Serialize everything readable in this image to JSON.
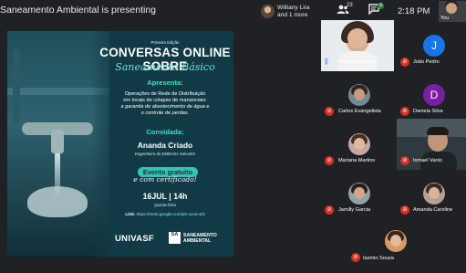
{
  "header": {
    "presenting_text": "Saneamento Ambiental is presenting",
    "pinned_names": [
      "Williany Lira",
      "and 1 more"
    ],
    "participants_count": "23",
    "chat_badge": "9",
    "time": "2:18 PM",
    "self_label": "You"
  },
  "slide": {
    "edition": "Primeira Edição",
    "title": "CONVERSAS ONLINE SOBRE",
    "subtitle": "Saneamento Básico",
    "presents_heading": "Apresenta:",
    "talk_line1": "Operações de Rede de Distribuição",
    "talk_line2": "em locais de colapso de mananciais:",
    "talk_line3": "a garantia do abastecimento de água e",
    "talk_line4": "o controle de perdas.",
    "guest_heading": "Convidada:",
    "guest_name": "Ananda Criado",
    "guest_role": "Engenheira da EMBASA Salvador",
    "free_event": "Evento gratuito",
    "certificate": "e com certificado!",
    "date": "16JUL | 14h",
    "weekday": "Quinta-feira",
    "link_label": "Link:",
    "link_url": "https://meet.google.com/pir-ucvw-phi",
    "logo_univasf": "UNIVASF",
    "logo_sa_mark": "SA",
    "logo_sa_line1": "SANEAMENTO",
    "logo_sa_line2": "AMBIENTAL"
  },
  "participants": [
    {
      "name": "Ananda Andrade",
      "muted": false,
      "kind": "video"
    },
    {
      "name": "João Pedro",
      "muted": true,
      "kind": "letter",
      "letter": "J",
      "color": "#1a73e8"
    },
    {
      "name": "Carlos Evangelista",
      "muted": true,
      "kind": "photo"
    },
    {
      "name": "Daniela Silva",
      "muted": true,
      "kind": "letter",
      "letter": "D",
      "color": "#7b1fa2"
    },
    {
      "name": "Mariana Martins",
      "muted": true,
      "kind": "photo"
    },
    {
      "name": "Ismael Vanio",
      "muted": true,
      "kind": "video"
    },
    {
      "name": "Jamilly Garcia",
      "muted": true,
      "kind": "photo"
    },
    {
      "name": "Amanda Caroline",
      "muted": true,
      "kind": "photo"
    },
    {
      "name": "Iasmin Souza",
      "muted": true,
      "kind": "photo"
    }
  ],
  "icons": {
    "participants": "people-icon",
    "chat": "chat-icon",
    "mic_off": "mic-off-icon",
    "speaking": "audio-level-icon"
  }
}
